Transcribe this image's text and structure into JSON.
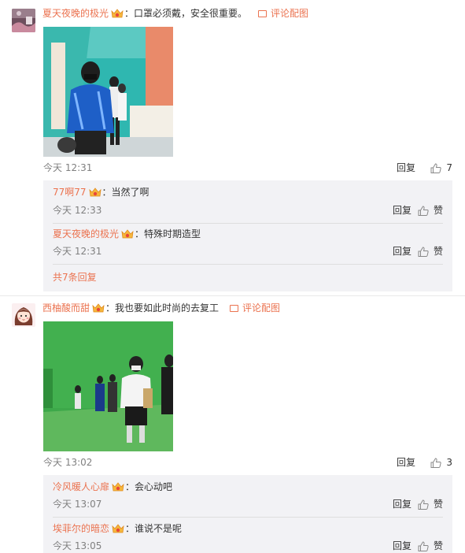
{
  "comments": [
    {
      "user": "夏天夜晚的极光",
      "text": "：口罩必须戴，安全很重要。",
      "pic_link": "评论配图",
      "time": "今天 12:31",
      "reply": "回复",
      "likes": "7",
      "replies": [
        {
          "user": "77啊77",
          "text": "：当然了啊",
          "time": "今天 12:33",
          "reply": "回复",
          "like": "赞"
        },
        {
          "user": "夏天夜晚的极光",
          "text": "：特殊时期造型",
          "time": "今天 12:31",
          "reply": "回复",
          "like": "赞"
        }
      ],
      "more_replies": "共7条回复"
    },
    {
      "user": "西柚酸而甜",
      "text": "：我也要如此时尚的去复工",
      "pic_link": "评论配图",
      "time": "今天 13:02",
      "reply": "回复",
      "likes": "3",
      "replies": [
        {
          "user": "冷风暖人心扉",
          "text": "：会心动吧",
          "time": "今天 13:07",
          "reply": "回复",
          "like": "赞"
        },
        {
          "user": "埃菲尔的暗恋",
          "text": "：谁说不是呢",
          "time": "今天 13:05",
          "reply": "回复",
          "like": "赞"
        }
      ]
    }
  ],
  "colors": {
    "username": "#eb7350",
    "subbox_bg": "#f2f2f5",
    "meta": "#808080"
  }
}
